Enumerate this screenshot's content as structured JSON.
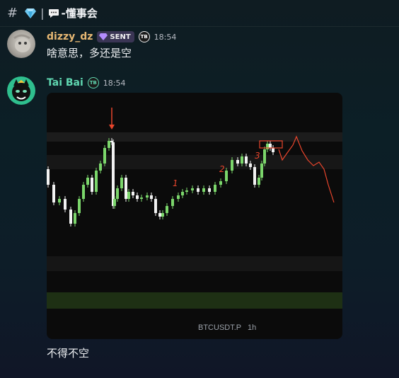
{
  "channel": {
    "name": "-懂事会",
    "separator": "|"
  },
  "messages": [
    {
      "username": "dizzy_dz",
      "badge": "SENT",
      "time": "18:54",
      "text": "啥意思，多还是空"
    },
    {
      "username": "Tai Bai",
      "time": "18:54",
      "text": "不得不空",
      "attachment": {
        "symbol": "BTCUSDT.P",
        "interval": "1h",
        "annotations": [
          "1",
          "2",
          "3"
        ]
      }
    }
  ],
  "colors": {
    "up_candle": "#7bd66b",
    "down_candle": "#f2f2f2",
    "annotation": "#e8452c",
    "username_1": "#e7b873",
    "username_2": "#5fd6b0"
  },
  "icons": {
    "channel": "hash-icon",
    "gem": "gem-icon",
    "bubble": "speech-bubble-icon",
    "tb": "tb-badge-icon"
  }
}
